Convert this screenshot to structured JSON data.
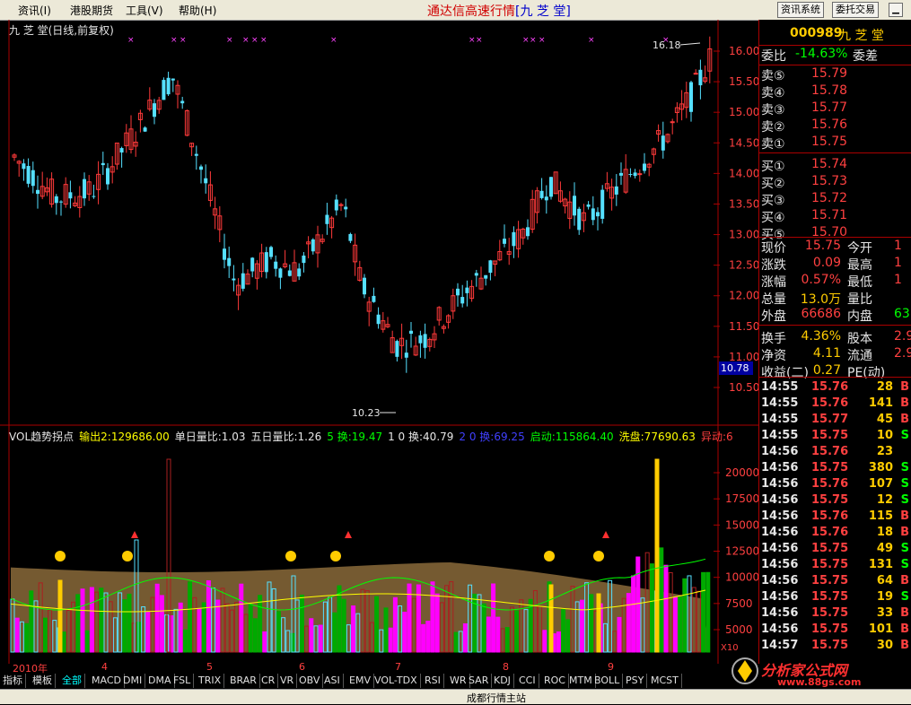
{
  "menu": {
    "items": [
      "资讯(I)",
      "港股期货",
      "工具(V)",
      "帮助(H)"
    ]
  },
  "app_title": {
    "main": "通达信高速行情",
    "stock": "[九 芝 堂]"
  },
  "toolbar": {
    "info_system": "资讯系统",
    "order_trade": "委托交易"
  },
  "colors": {
    "up": "#ff3a3a",
    "down": "#55e0ff",
    "yellow": "#ffff00",
    "cyan": "#00ffff"
  },
  "chart": {
    "title": "九 芝 堂(日线,前复权)",
    "high_label": "16.18",
    "low_label": "10.23",
    "price_ticks": [
      "16.00",
      "15.50",
      "15.00",
      "14.50",
      "14.00",
      "13.50",
      "13.00",
      "12.50",
      "12.00",
      "11.50",
      "11.00",
      "10.50"
    ],
    "current_price_tag": "10.78",
    "vol_ticks": [
      "20000",
      "17500",
      "15000",
      "12500",
      "10000",
      "7500",
      "5000"
    ],
    "vol_unit": "X10",
    "dates": [
      "2010年",
      "4",
      "5",
      "6",
      "7",
      "8",
      "9"
    ]
  },
  "vol_header": [
    {
      "text": "VOL趋势拐点",
      "color": "#e6e6e6"
    },
    {
      "text": "输出2:129686.00",
      "color": "#ffff00"
    },
    {
      "text": "单日量比:1.03",
      "color": "#e6e6e6"
    },
    {
      "text": "五日量比:1.26",
      "color": "#e6e6e6"
    },
    {
      "text": "5 换:19.47",
      "color": "#00ff00"
    },
    {
      "text": "1 0 换:40.79",
      "color": "#e6e6e6"
    },
    {
      "text": "2 0 换:69.25",
      "color": "#4040ff"
    },
    {
      "text": "启动:115864.40",
      "color": "#00ff00"
    },
    {
      "text": "洗盘:77690.63",
      "color": "#ffff00"
    },
    {
      "text": "异动:6",
      "color": "#ff4040"
    }
  ],
  "quote": {
    "code": "000989",
    "name": "九 芝 堂",
    "weibi_label": "委比",
    "weibi_value": "-14.63%",
    "weicha_label": "委差",
    "sells": [
      {
        "label": "卖⑤",
        "price": "15.79"
      },
      {
        "label": "卖④",
        "price": "15.78"
      },
      {
        "label": "卖③",
        "price": "15.77"
      },
      {
        "label": "卖②",
        "price": "15.76"
      },
      {
        "label": "卖①",
        "price": "15.75"
      }
    ],
    "buys": [
      {
        "label": "买①",
        "price": "15.74"
      },
      {
        "label": "买②",
        "price": "15.73"
      },
      {
        "label": "买③",
        "price": "15.72"
      },
      {
        "label": "买④",
        "price": "15.71"
      },
      {
        "label": "买⑤",
        "price": "15.70"
      }
    ],
    "stats": [
      {
        "l1": "现价",
        "v1": "15.75",
        "l2": "今开",
        "v2": "1"
      },
      {
        "l1": "涨跌",
        "v1": "0.09",
        "l2": "最高",
        "v2": "1"
      },
      {
        "l1": "涨幅",
        "v1": "0.57%",
        "l2": "最低",
        "v2": "1"
      },
      {
        "l1": "总量",
        "v1": "13.0万",
        "l2": "量比",
        "v2": ""
      },
      {
        "l1": "外盘",
        "v1": "66686",
        "l2": "内盘",
        "v2": "63"
      },
      {
        "l1": "换手",
        "v1": "4.36%",
        "l2": "股本",
        "v2": "2.9"
      },
      {
        "l1": "净资",
        "v1": "4.11",
        "l2": "流通",
        "v2": "2.9"
      },
      {
        "l1": "收益(二)",
        "v1": "0.27",
        "l2": "PE(动)",
        "v2": ""
      }
    ],
    "ticks": [
      {
        "t": "14:55",
        "p": "15.76",
        "v": "28",
        "d": "B"
      },
      {
        "t": "14:55",
        "p": "15.76",
        "v": "141",
        "d": "B"
      },
      {
        "t": "14:55",
        "p": "15.77",
        "v": "45",
        "d": "B"
      },
      {
        "t": "14:55",
        "p": "15.75",
        "v": "10",
        "d": "S"
      },
      {
        "t": "14:56",
        "p": "15.76",
        "v": "23",
        "d": ""
      },
      {
        "t": "14:56",
        "p": "15.75",
        "v": "380",
        "d": "S"
      },
      {
        "t": "14:56",
        "p": "15.76",
        "v": "107",
        "d": "S"
      },
      {
        "t": "14:56",
        "p": "15.75",
        "v": "12",
        "d": "S"
      },
      {
        "t": "14:56",
        "p": "15.76",
        "v": "115",
        "d": "B"
      },
      {
        "t": "14:56",
        "p": "15.76",
        "v": "18",
        "d": "B"
      },
      {
        "t": "14:56",
        "p": "15.75",
        "v": "49",
        "d": "S"
      },
      {
        "t": "14:56",
        "p": "15.75",
        "v": "131",
        "d": "S"
      },
      {
        "t": "14:56",
        "p": "15.75",
        "v": "64",
        "d": "B"
      },
      {
        "t": "14:56",
        "p": "15.75",
        "v": "19",
        "d": "S"
      },
      {
        "t": "14:56",
        "p": "15.75",
        "v": "33",
        "d": "B"
      },
      {
        "t": "14:56",
        "p": "15.75",
        "v": "101",
        "d": "B"
      },
      {
        "t": "14:57",
        "p": "15.75",
        "v": "30",
        "d": "B"
      }
    ]
  },
  "indicator_tabs": [
    "指标",
    "模板",
    "全部",
    "MACD",
    "DMI",
    "DMA",
    "FSL",
    "TRIX",
    "BRAR",
    "CR",
    "VR",
    "OBV",
    "ASI",
    "EMV",
    "VOL-TDX",
    "RSI",
    "WR",
    "SAR",
    "KDJ",
    "CCI",
    "ROC",
    "MTM",
    "BOLL",
    "PSY",
    "MCST"
  ],
  "status": {
    "text": "成都行情主站"
  },
  "logo": {
    "text": "分析家公式网",
    "url": "www.88gs.com"
  }
}
